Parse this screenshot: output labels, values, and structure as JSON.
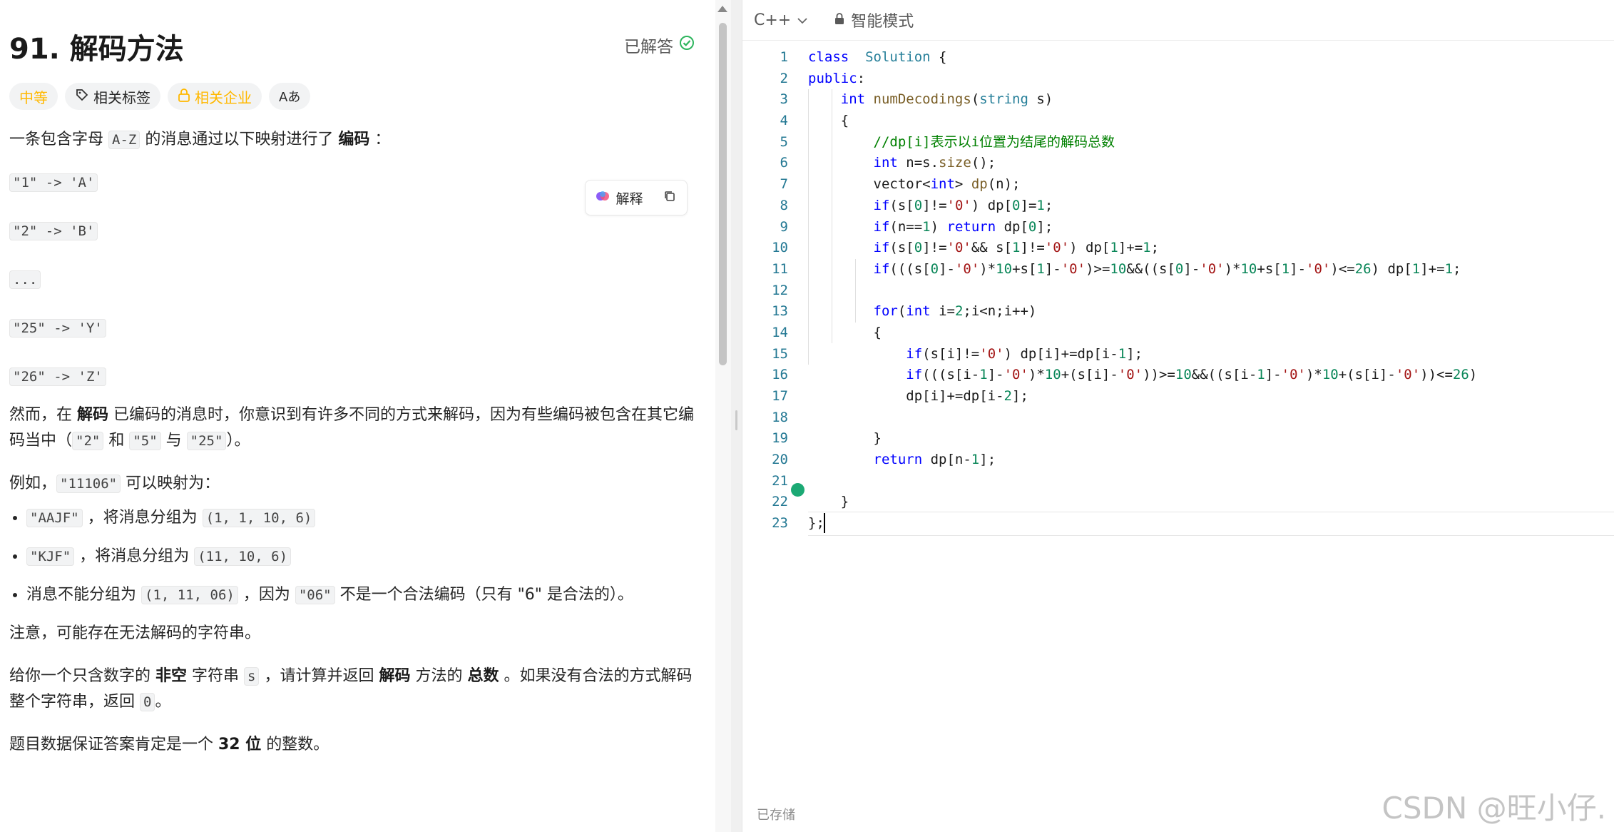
{
  "problem": {
    "title": "91. 解码方法",
    "status": "已解答",
    "tags": {
      "difficulty": "中等",
      "related_tags": "相关标签",
      "related_companies": "相关企业",
      "translate": "Aあ"
    },
    "explain_button": "解释",
    "p1_a": "一条包含字母 ",
    "p1_code": "A-Z",
    "p1_b": " 的消息通过以下映射进行了 ",
    "p1_bold": "编码",
    "p1_c": " ：",
    "mappings": [
      "\"1\" -> 'A'",
      "\"2\" -> 'B'",
      "...",
      "\"25\" -> 'Y'",
      "\"26\" -> 'Z'"
    ],
    "p2_a": "然而，在 ",
    "p2_bold": "解码",
    "p2_b": " 已编码的消息时，你意识到有许多不同的方式来解码，因为有些编码被包含在其它编码当中（",
    "p2_c1": "\"2\"",
    "p2_and": " 和 ",
    "p2_c2": "\"5\"",
    "p2_with": " 与 ",
    "p2_c3": "\"25\"",
    "p2_end": "）。",
    "p3_a": "例如，",
    "p3_code": "\"11106\"",
    "p3_b": " 可以映射为：",
    "bullets": [
      {
        "code": "\"AAJF\"",
        "text": " ，将消息分组为 ",
        "group": "(1, 1, 10, 6)",
        "tail": ""
      },
      {
        "code": "\"KJF\"",
        "text": " ，将消息分组为 ",
        "group": "(11, 10, 6)",
        "tail": ""
      }
    ],
    "b3_a": "消息不能分组为 ",
    "b3_code1": "(1, 11, 06)",
    "b3_b": " ，因为 ",
    "b3_code2": "\"06\"",
    "b3_c": " 不是一个合法编码（只有 \"6\" 是合法的）。",
    "p4": "注意，可能存在无法解码的字符串。",
    "p5_a": "给你一个只含数字的 ",
    "p5_bold1": "非空",
    "p5_b": " 字符串 ",
    "p5_code1": "s",
    "p5_c": " ，请计算并返回 ",
    "p5_bold2": "解码",
    "p5_d": " 方法的 ",
    "p5_bold3": "总数",
    "p5_e": " 。如果没有合法的方式解码整个字符串，返回 ",
    "p5_code2": "0",
    "p5_f": "。",
    "p6_a": "题目数据保证答案肯定是一个 ",
    "p6_bold": "32 位",
    "p6_b": " 的整数。"
  },
  "editor": {
    "language": "C++",
    "mode": "智能模式",
    "saved": "已存储",
    "lines": [
      [
        [
          "kw",
          "class"
        ],
        [
          "",
          "  "
        ],
        [
          "ty",
          "Solution"
        ],
        [
          "",
          " {"
        ]
      ],
      [
        [
          "kw",
          "public"
        ],
        [
          "",
          ":"
        ]
      ],
      [
        [
          "",
          "    "
        ],
        [
          "kw",
          "int"
        ],
        [
          "",
          " "
        ],
        [
          "fn",
          "numDecodings"
        ],
        [
          "",
          "("
        ],
        [
          "ty",
          "string"
        ],
        [
          "",
          " s)"
        ]
      ],
      [
        [
          "",
          "    {"
        ]
      ],
      [
        [
          "",
          "        "
        ],
        [
          "cm",
          "//dp[i]表示以i位置为结尾的解码总数"
        ]
      ],
      [
        [
          "",
          "        "
        ],
        [
          "kw",
          "int"
        ],
        [
          "",
          " n=s."
        ],
        [
          "fn",
          "size"
        ],
        [
          "",
          "();"
        ]
      ],
      [
        [
          "",
          "        vector<"
        ],
        [
          "kw",
          "int"
        ],
        [
          "",
          "> "
        ],
        [
          "fn",
          "dp"
        ],
        [
          "",
          "(n);"
        ]
      ],
      [
        [
          "",
          "        "
        ],
        [
          "kw",
          "if"
        ],
        [
          "",
          "(s["
        ],
        [
          "nu",
          "0"
        ],
        [
          "",
          "]!="
        ],
        [
          "st",
          "'0'"
        ],
        [
          "",
          ") dp["
        ],
        [
          "nu",
          "0"
        ],
        [
          "",
          "]="
        ],
        [
          "nu",
          "1"
        ],
        [
          "",
          ";"
        ]
      ],
      [
        [
          "",
          "        "
        ],
        [
          "kw",
          "if"
        ],
        [
          "",
          "(n=="
        ],
        [
          "nu",
          "1"
        ],
        [
          "",
          ") "
        ],
        [
          "kw",
          "return"
        ],
        [
          "",
          " dp["
        ],
        [
          "nu",
          "0"
        ],
        [
          "",
          "];"
        ]
      ],
      [
        [
          "",
          "        "
        ],
        [
          "kw",
          "if"
        ],
        [
          "",
          "(s["
        ],
        [
          "nu",
          "0"
        ],
        [
          "",
          "]!="
        ],
        [
          "st",
          "'0'"
        ],
        [
          "",
          "&& s["
        ],
        [
          "nu",
          "1"
        ],
        [
          "",
          "]!="
        ],
        [
          "st",
          "'0'"
        ],
        [
          "",
          ") dp["
        ],
        [
          "nu",
          "1"
        ],
        [
          "",
          "]+="
        ],
        [
          "nu",
          "1"
        ],
        [
          "",
          ";"
        ]
      ],
      [
        [
          "",
          "        "
        ],
        [
          "kw",
          "if"
        ],
        [
          "",
          "(((s["
        ],
        [
          "nu",
          "0"
        ],
        [
          "",
          "]-"
        ],
        [
          "st",
          "'0'"
        ],
        [
          "",
          ")*"
        ],
        [
          "nu",
          "10"
        ],
        [
          "",
          "+s["
        ],
        [
          "nu",
          "1"
        ],
        [
          "",
          "]-"
        ],
        [
          "st",
          "'0'"
        ],
        [
          "",
          ")>="
        ],
        [
          "nu",
          "10"
        ],
        [
          "",
          "&&((s["
        ],
        [
          "nu",
          "0"
        ],
        [
          "",
          "]-"
        ],
        [
          "st",
          "'0'"
        ],
        [
          "",
          ")*"
        ],
        [
          "nu",
          "10"
        ],
        [
          "",
          "+s["
        ],
        [
          "nu",
          "1"
        ],
        [
          "",
          "]-"
        ],
        [
          "st",
          "'0'"
        ],
        [
          "",
          ")<="
        ],
        [
          "nu",
          "26"
        ],
        [
          "",
          ") dp["
        ],
        [
          "nu",
          "1"
        ],
        [
          "",
          "]+="
        ],
        [
          "nu",
          "1"
        ],
        [
          "",
          ";"
        ]
      ],
      [
        [
          "",
          ""
        ]
      ],
      [
        [
          "",
          "        "
        ],
        [
          "kw",
          "for"
        ],
        [
          "",
          "("
        ],
        [
          "kw",
          "int"
        ],
        [
          "",
          " i="
        ],
        [
          "nu",
          "2"
        ],
        [
          "",
          ";i<n;i++)"
        ]
      ],
      [
        [
          "",
          "        {"
        ]
      ],
      [
        [
          "",
          "            "
        ],
        [
          "kw",
          "if"
        ],
        [
          "",
          "(s[i]!="
        ],
        [
          "st",
          "'0'"
        ],
        [
          "",
          ") dp[i]+=dp[i-"
        ],
        [
          "nu",
          "1"
        ],
        [
          "",
          "];"
        ]
      ],
      [
        [
          "",
          "            "
        ],
        [
          "kw",
          "if"
        ],
        [
          "",
          "(((s[i-"
        ],
        [
          "nu",
          "1"
        ],
        [
          "",
          "]-"
        ],
        [
          "st",
          "'0'"
        ],
        [
          "",
          ")*"
        ],
        [
          "nu",
          "10"
        ],
        [
          "",
          "+(s[i]-"
        ],
        [
          "st",
          "'0'"
        ],
        [
          "",
          "))>="
        ],
        [
          "nu",
          "10"
        ],
        [
          "",
          "&&((s[i-"
        ],
        [
          "nu",
          "1"
        ],
        [
          "",
          "]-"
        ],
        [
          "st",
          "'0'"
        ],
        [
          "",
          ")*"
        ],
        [
          "nu",
          "10"
        ],
        [
          "",
          "+(s[i]-"
        ],
        [
          "st",
          "'0'"
        ],
        [
          "",
          "))<="
        ],
        [
          "nu",
          "26"
        ],
        [
          "",
          ")"
        ]
      ],
      [
        [
          "",
          "            dp[i]+=dp[i-"
        ],
        [
          "nu",
          "2"
        ],
        [
          "",
          "];"
        ]
      ],
      [
        [
          "",
          ""
        ]
      ],
      [
        [
          "",
          "        }"
        ]
      ],
      [
        [
          "",
          "        "
        ],
        [
          "kw",
          "return"
        ],
        [
          "",
          " dp[n-"
        ],
        [
          "nu",
          "1"
        ],
        [
          "",
          "];"
        ]
      ],
      [
        [
          "",
          ""
        ]
      ],
      [
        [
          "",
          "    }"
        ]
      ],
      [
        [
          "",
          "};"
        ]
      ]
    ]
  },
  "watermark": "CSDN @旺小仔."
}
